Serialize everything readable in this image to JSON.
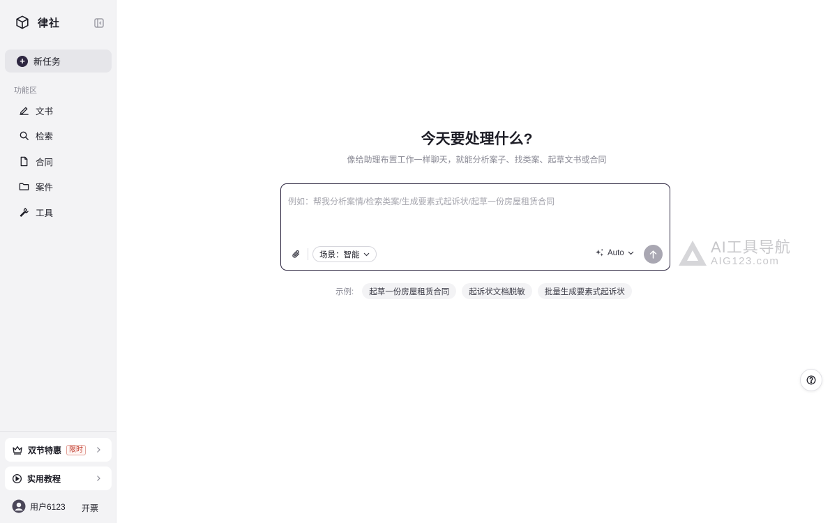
{
  "brand": {
    "name": "律社",
    "icon": "cube-icon"
  },
  "sidebar": {
    "collapse_icon": "sidebar-collapse-icon",
    "new_task_label": "新任务",
    "section_label": "功能区",
    "items": [
      {
        "label": "文书",
        "icon": "pen-icon"
      },
      {
        "label": "检索",
        "icon": "search-icon"
      },
      {
        "label": "合同",
        "icon": "document-icon"
      },
      {
        "label": "案件",
        "icon": "folder-icon"
      },
      {
        "label": "工具",
        "icon": "wrench-icon"
      }
    ],
    "promo": {
      "label": "双节特惠",
      "badge": "限时",
      "icon": "crown-icon"
    },
    "tutorial": {
      "label": "实用教程",
      "icon": "play-circle-icon"
    },
    "user": {
      "name": "用户6123",
      "invoice_label": "开票"
    }
  },
  "main": {
    "headline": "今天要处理什么?",
    "subheadline": "像给助理布置工作一样聊天，就能分析案子、找类案、起草文书或合同",
    "composer": {
      "placeholder": "例如：帮我分析案情/检索类案/生成要素式起诉状/起草一份房屋租赁合同",
      "value": "",
      "scene_label": "场景：智能",
      "model_label": "Auto"
    },
    "examples": {
      "label": "示例:",
      "items": [
        "起草一份房屋租赁合同",
        "起诉状文档脱敏",
        "批量生成要素式起诉状"
      ]
    }
  },
  "watermark": {
    "title": "AI工具导航",
    "subtitle": "AIG123.com"
  },
  "colors": {
    "accent": "#2d2640",
    "sidebar_bg": "#f3f3f5",
    "send_disabled": "#a9a7b2"
  }
}
